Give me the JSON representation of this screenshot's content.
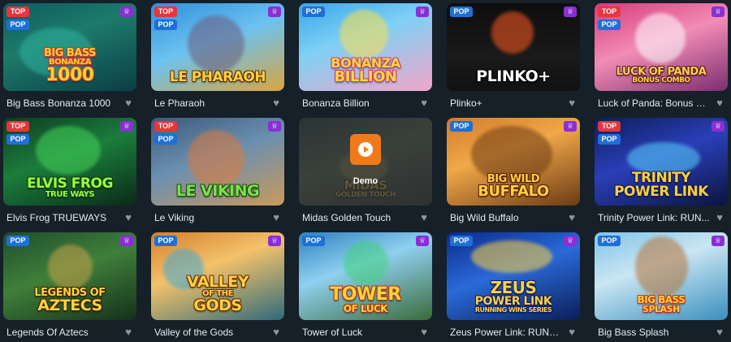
{
  "badges": {
    "top": "TOP",
    "pop": "POP"
  },
  "icons": {
    "trophy": "trophy-icon",
    "heart": "heart-icon",
    "play": "play-icon"
  },
  "demo_label": "Demo",
  "games": [
    {
      "name": "Big Bass Bonanza 1000",
      "badges": [
        "TOP",
        "POP"
      ],
      "art": {
        "l1": "BIG BASS",
        "l2": "BONANZA",
        "l3": "1000"
      }
    },
    {
      "name": "Le Pharaoh",
      "badges": [
        "TOP",
        "POP"
      ],
      "art": {
        "l1": "",
        "l2": "",
        "l3": "LE PHARAOH"
      }
    },
    {
      "name": "Bonanza Billion",
      "badges": [
        "POP"
      ],
      "art": {
        "l1": "",
        "l2": "BONANZA",
        "l3": "BILLION"
      }
    },
    {
      "name": "Plinko+",
      "badges": [
        "POP"
      ],
      "art": {
        "l1": "",
        "l2": "",
        "l3": "PLINKO+"
      }
    },
    {
      "name": "Luck of Panda: Bonus C...",
      "badges": [
        "TOP",
        "POP"
      ],
      "art": {
        "l1": "",
        "l2": "LUCK OF PANDA",
        "l3": "BONUS COMBO"
      }
    },
    {
      "name": "Elvis Frog TRUEWAYS",
      "badges": [
        "TOP",
        "POP"
      ],
      "art": {
        "l1": "",
        "l2": "ELVIS FROG",
        "l3": "TRUE WAYS"
      }
    },
    {
      "name": "Le Viking",
      "badges": [
        "TOP",
        "POP"
      ],
      "art": {
        "l1": "",
        "l2": "",
        "l3": "LE VIKING"
      }
    },
    {
      "name": "Midas Golden Touch",
      "badges": [],
      "art": {
        "l1": "",
        "l2": "MIDAS",
        "l3": "GOLDEN TOUCH"
      },
      "demo": true
    },
    {
      "name": "Big Wild Buffalo",
      "badges": [
        "POP"
      ],
      "art": {
        "l1": "",
        "l2": "BIG WILD",
        "l3": "BUFFALO"
      }
    },
    {
      "name": "Trinity Power Link: RUN...",
      "badges": [
        "TOP",
        "POP"
      ],
      "art": {
        "l1": "",
        "l2": "TRINITY",
        "l3": "POWER LINK"
      }
    },
    {
      "name": "Legends Of Aztecs",
      "badges": [
        "POP"
      ],
      "art": {
        "l1": "",
        "l2": "LEGENDS OF",
        "l3": "AZTECS"
      }
    },
    {
      "name": "Valley of the Gods",
      "badges": [
        "POP"
      ],
      "art": {
        "l1": "VALLEY",
        "l2": "OF THE",
        "l3": "GODS"
      }
    },
    {
      "name": "Tower of Luck",
      "badges": [
        "POP"
      ],
      "art": {
        "l1": "",
        "l2": "TOWER",
        "l3": "OF LUCK"
      }
    },
    {
      "name": "Zeus Power Link: RUNNI...",
      "badges": [
        "POP"
      ],
      "art": {
        "l1": "ZEUS",
        "l2": "POWER LINK",
        "l3": "RUNNING WINS SERIES"
      }
    },
    {
      "name": "Big Bass Splash",
      "badges": [
        "POP"
      ],
      "art": {
        "l1": "",
        "l2": "BIG BASS",
        "l3": "SPLASH"
      }
    }
  ]
}
